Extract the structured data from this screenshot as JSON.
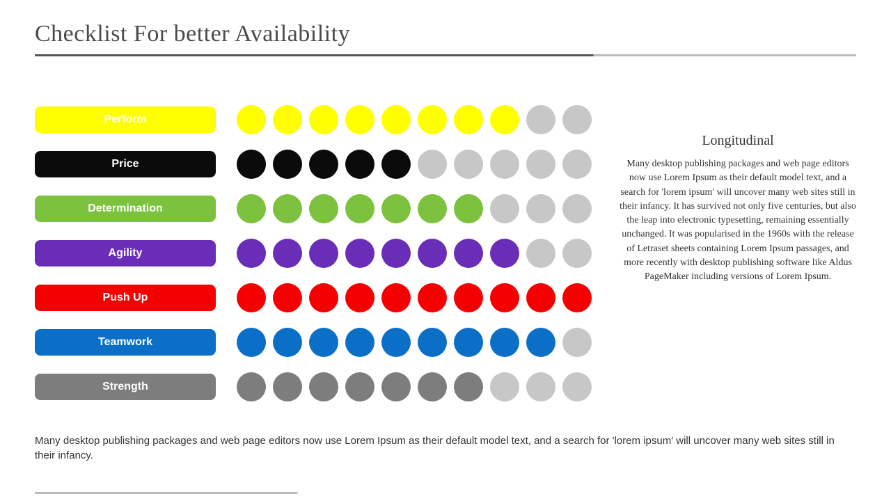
{
  "title": "Checklist For better Availability",
  "chart_data": {
    "type": "bar",
    "title": "Checklist For better Availability",
    "categories": [
      "Perform",
      "Price",
      "Determination",
      "Agility",
      "Push Up",
      "Teamwork",
      "Strength"
    ],
    "values": [
      8,
      5,
      7,
      8,
      10,
      9,
      7
    ],
    "max": 10,
    "series_colors": [
      "#FFFF00",
      "#0B0B0B",
      "#7CC23F",
      "#6A2DB8",
      "#F40000",
      "#0B6FC8",
      "#7D7D7D"
    ],
    "empty_color": "#C7C7C7"
  },
  "sidebar": {
    "title": "Longitudinal",
    "body": "Many desktop publishing packages and web page editors now use Lorem Ipsum as their default model text, and a search for 'lorem ipsum' will uncover many web sites still in their infancy. It has survived not only five centuries, but also the leap into electronic typesetting, remaining essentially unchanged. It was popularised in the 1960s with the release of Letraset sheets containing Lorem Ipsum passages, and more recently with desktop publishing software like Aldus PageMaker including versions of Lorem Ipsum."
  },
  "footer": "Many desktop publishing packages and web page editors now use Lorem Ipsum as their default model text, and a search for 'lorem ipsum' will uncover many web sites still in their infancy."
}
